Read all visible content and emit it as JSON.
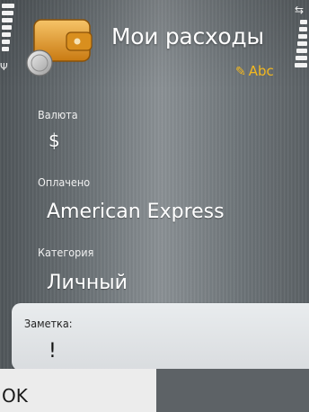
{
  "header": {
    "title": "Мои расходы",
    "input_mode": "Abc"
  },
  "fields": [
    {
      "label": "Валюта",
      "value": "$"
    },
    {
      "label": "Оплачено",
      "value": "American Express"
    },
    {
      "label": "Категория",
      "value": "Личный"
    }
  ],
  "note": {
    "label": "Заметка:",
    "value": "!"
  },
  "softkeys": {
    "left": "OK"
  },
  "colors": {
    "accent": "#f3b81f",
    "background": "#6b7276",
    "note_panel": "#e4e7ea"
  },
  "icons": [
    "wallet-app-icon",
    "signal-icon",
    "battery-icon",
    "sync-icon",
    "pen-icon"
  ]
}
